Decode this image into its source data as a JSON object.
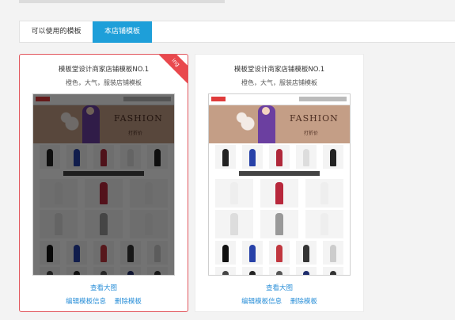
{
  "tabs": [
    "可以使用的模板",
    "本店铺模板"
  ],
  "cards": [
    {
      "title": "模板堂设计商家店铺模板NO.1",
      "subtitle": "橙色，大气，服装店铺模板",
      "badge": "ing",
      "view_link": "查看大图",
      "edit_link": "编辑模板信息",
      "delete_link": "删除模板",
      "selected": true
    },
    {
      "title": "模板堂设计商家店铺模板NO.1",
      "subtitle": "橙色，大气，服装店铺模板",
      "view_link": "查看大图",
      "edit_link": "编辑模板信息",
      "delete_link": "删除模板",
      "selected": false
    }
  ],
  "thumbnail": {
    "banner_text": "FASHION",
    "banner_sub": "打折价"
  },
  "colors": {
    "accent": "#1e9fd9",
    "selected_border": "#e1565d",
    "badge": "#e9484d",
    "link": "#2a8fd8"
  }
}
